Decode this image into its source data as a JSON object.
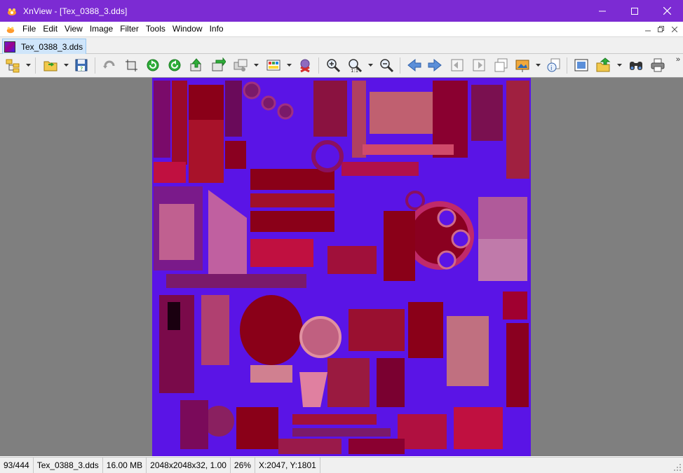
{
  "window": {
    "title": "XnView - [Tex_0388_3.dds]",
    "accent_color": "#7c2bd3"
  },
  "menubar": {
    "items": [
      "File",
      "Edit",
      "View",
      "Image",
      "Filter",
      "Tools",
      "Window",
      "Info"
    ]
  },
  "tabs": [
    {
      "label": "Tex_0388_3.dds",
      "active": true
    }
  ],
  "toolbar": {
    "buttons": [
      "browser-tree-icon",
      "open-folder-icon",
      "save-icon",
      "undo-icon",
      "crop-icon",
      "rotate-left-icon",
      "rotate-right-icon",
      "export-icon",
      "convert-icon",
      "batch-icon",
      "palette-icon",
      "delete-icon",
      "zoom-in-icon",
      "zoom-actual-icon",
      "zoom-out-icon",
      "previous-icon",
      "next-icon",
      "first-page-icon",
      "last-page-icon",
      "multipage-icon",
      "slideshow-icon",
      "properties-icon",
      "fullscreen-icon",
      "acquire-icon",
      "find-icon",
      "print-icon"
    ]
  },
  "image": {
    "name": "Tex_0388_3.dds",
    "dominant_color": "#5a14e6",
    "secondary_color": "#8a0010"
  },
  "status": {
    "position": "93/444",
    "filename": "Tex_0388_3.dds",
    "filesize": "16.00 MB",
    "dimensions": "2048x2048x32, 1.00",
    "zoom": "26%",
    "coords": "X:2047, Y:1801"
  }
}
